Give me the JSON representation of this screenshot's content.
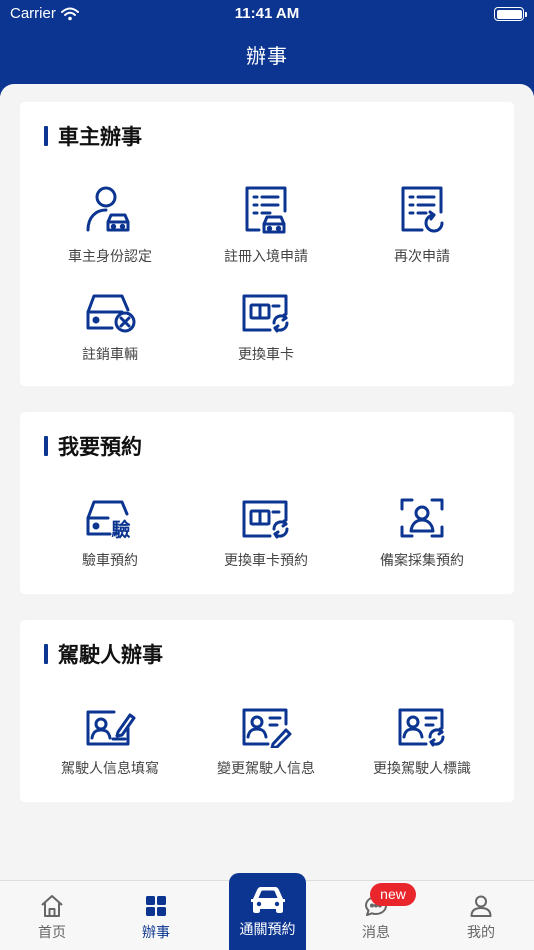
{
  "status_bar": {
    "carrier": "Carrier",
    "time": "11:41 AM"
  },
  "nav": {
    "title": "辦事"
  },
  "sections": [
    {
      "title": "車主辦事",
      "items": [
        {
          "label": "車主身份認定",
          "icon": "owner-car-icon"
        },
        {
          "label": "註冊入境申請",
          "icon": "register-entry-icon"
        },
        {
          "label": "再次申請",
          "icon": "reapply-icon"
        },
        {
          "label": "註銷車輛",
          "icon": "cancel-vehicle-icon"
        },
        {
          "label": "更換車卡",
          "icon": "replace-card-icon"
        }
      ]
    },
    {
      "title": "我要預約",
      "items": [
        {
          "label": "驗車預約",
          "icon": "inspection-car-icon",
          "glyph": "驗"
        },
        {
          "label": "更換車卡預約",
          "icon": "replace-card-icon"
        },
        {
          "label": "備案採集預約",
          "icon": "face-scan-icon"
        }
      ]
    },
    {
      "title": "駕駛人辦事",
      "items": [
        {
          "label": "駕駛人信息填寫",
          "icon": "id-card-pen-icon"
        },
        {
          "label": "變更駕駛人信息",
          "icon": "id-card-edit-icon"
        },
        {
          "label": "更換駕駛人標識",
          "icon": "id-card-refresh-icon"
        }
      ]
    }
  ],
  "tabbar": {
    "tabs": [
      {
        "label": "首页",
        "icon": "home-icon"
      },
      {
        "label": "辦事",
        "icon": "grid-icon",
        "active": true
      },
      {
        "label": "通關預約",
        "icon": "car-icon"
      },
      {
        "label": "消息",
        "icon": "chat-icon",
        "badge": "new"
      },
      {
        "label": "我的",
        "icon": "user-icon"
      }
    ]
  },
  "colors": {
    "primary": "#0b3590",
    "badge": "#e9262c",
    "background": "#f4f4f4"
  }
}
